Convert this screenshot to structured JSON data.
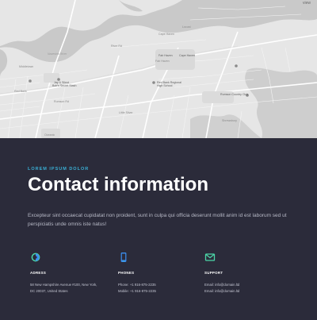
{
  "map": {
    "labels": {
      "top_right": "view",
      "cape_haven": "Cape Haven",
      "fair_haven_1": "Fair Haven",
      "fair_haven_2": "Cape Haven",
      "shelter_park": "Fair Haven",
      "harbour": "Jay & Silent",
      "harbour_2": "Bob's Secret Stash",
      "school_1": "Red Bank Regional",
      "school_2": "High School",
      "club_1": "Rumson Country Club",
      "bank_1": "Red Bank",
      "bank_2": "Oceanic",
      "water_1": "Navesink River",
      "loc_1": "Locust",
      "loc_2": "Middletown",
      "road_1": "Rumson Rd",
      "road_2": "River Rd",
      "area_1": "Little Silver",
      "area_2": "Shrewsbury"
    }
  },
  "contact": {
    "eyebrow": "LOREM IPSUM DOLOR",
    "title": "Contact information",
    "intro": "Excepteur sint occaecat cupidatat non proident, sunt in culpa qui officia deserunt mollit anim id est laborum sed ut perspiciatis unde omnis iste natus!",
    "columns": [
      {
        "icon": "location-pin-icon",
        "title": "ADRESS",
        "lines": [
          "58 New Hampshire Avenue #100, New York,",
          "DC 20037, United States"
        ]
      },
      {
        "icon": "phone-icon",
        "title": "PHONES",
        "lines": [
          "Phone: +1 916-875-2235",
          "Mobile: +1 916-875-2235"
        ]
      },
      {
        "icon": "envelope-icon",
        "title": "SUPPORT",
        "lines": [
          "Email: info@domain.ltd",
          "Email: info@domain.ltd"
        ]
      }
    ],
    "colors": {
      "accent": "#3ab0d6",
      "background": "#2b2b3a",
      "icon_green": "#4bd6a8",
      "icon_blue": "#3b8ff0"
    }
  }
}
